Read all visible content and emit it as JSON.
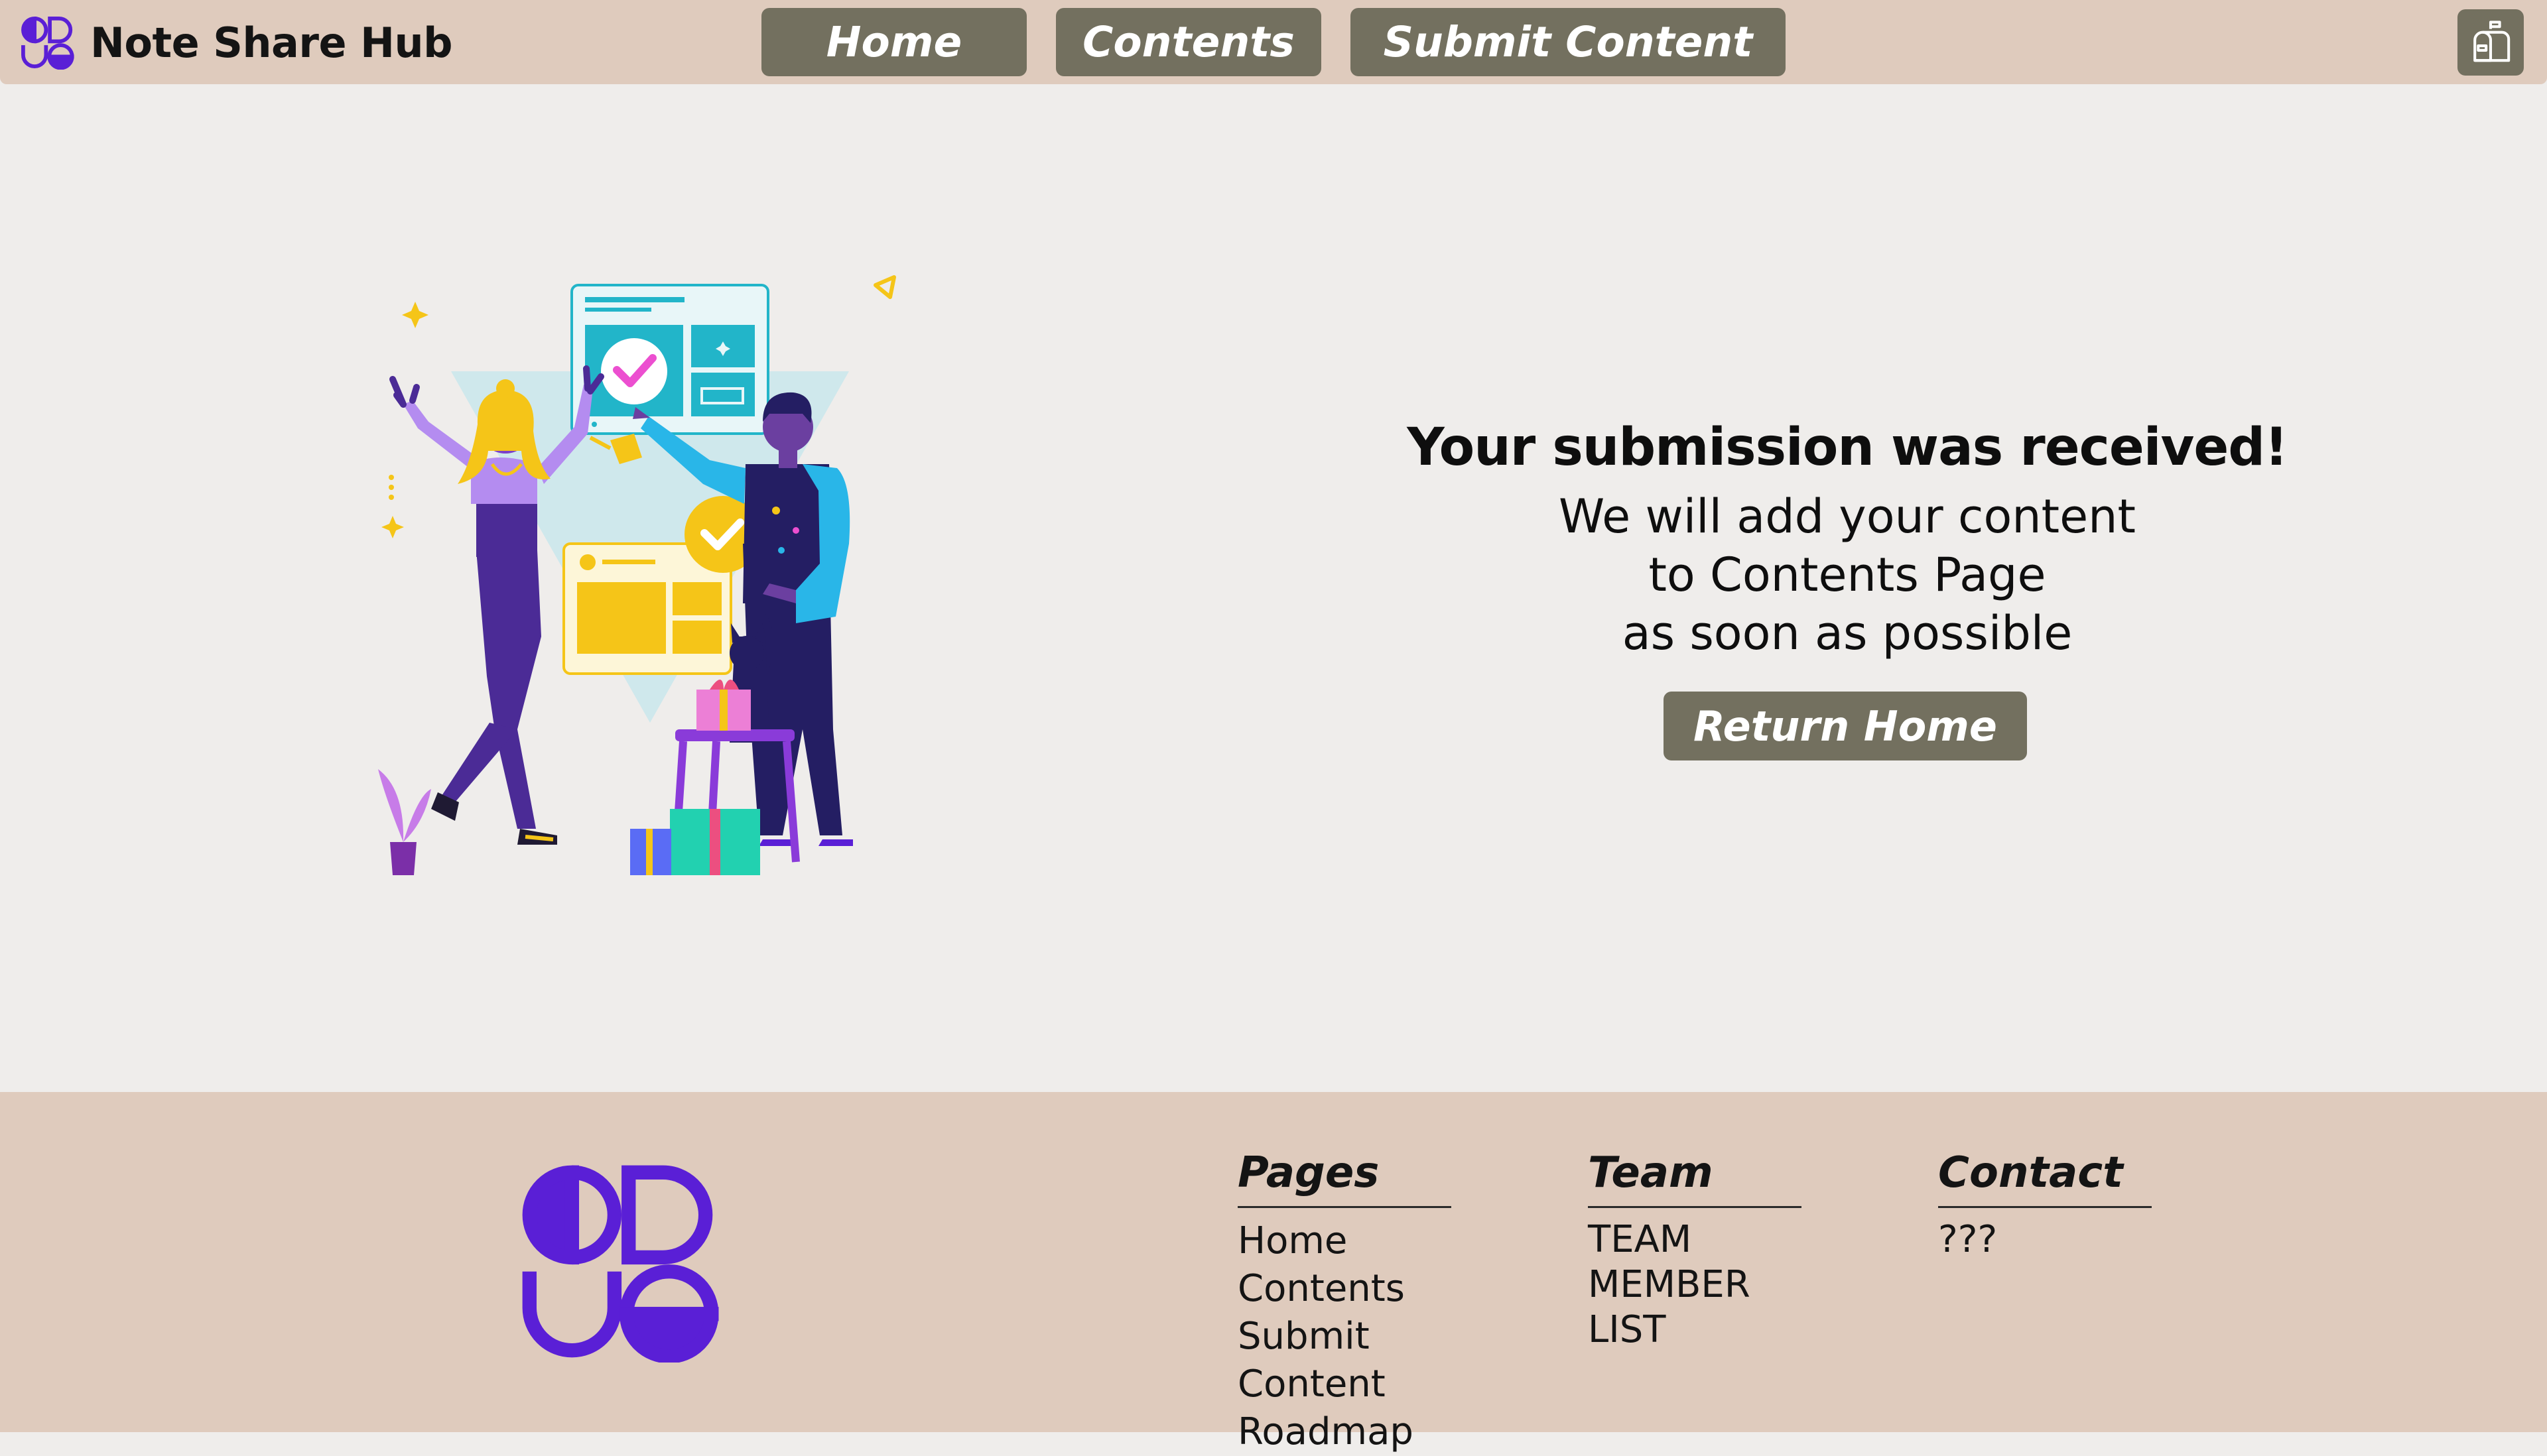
{
  "header": {
    "brand_name": "Note Share Hub",
    "nav": {
      "home": "Home",
      "contents": "Contents",
      "submit": "Submit Content"
    },
    "mail_icon": "mailbox-icon"
  },
  "main": {
    "title": "Your submission was received!",
    "lines": [
      "We will add your content",
      "to Contents Page",
      "as soon as possible"
    ],
    "return_button": "Return Home",
    "illustration": "celebration-illustration"
  },
  "footer": {
    "pages": {
      "heading": "Pages",
      "items": [
        "Home",
        "Contents",
        "Submit Content",
        "Roadmap"
      ]
    },
    "team": {
      "heading": "Team",
      "lines": [
        "TEAM",
        "MEMBER",
        "LIST"
      ]
    },
    "contact": {
      "heading": "Contact",
      "value": "???"
    }
  },
  "colors": {
    "header_bg": "#dfcbbd",
    "page_bg": "#efedeb",
    "button_bg": "#73705f",
    "brand_purple": "#5a1fd6"
  }
}
